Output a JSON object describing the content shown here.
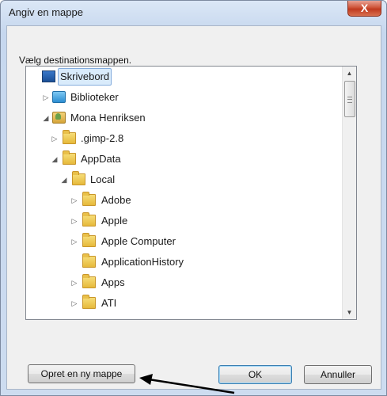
{
  "dialog": {
    "title": "Angiv en mappe",
    "close_label": "X",
    "instruction": "Vælg destinationsmappen."
  },
  "tree": {
    "items": [
      {
        "label": "Skrivebord",
        "icon": "desktop-icon",
        "expander": "none",
        "selected": true
      },
      {
        "label": "Biblioteker",
        "icon": "library-icon",
        "expander": "collapsed"
      },
      {
        "label": "Mona Henriksen",
        "icon": "user-folder-icon",
        "expander": "expanded"
      },
      {
        "label": ".gimp-2.8",
        "icon": "folder-icon",
        "expander": "collapsed"
      },
      {
        "label": "AppData",
        "icon": "folder-icon",
        "expander": "expanded"
      },
      {
        "label": "Local",
        "icon": "folder-icon",
        "expander": "expanded"
      },
      {
        "label": "Adobe",
        "icon": "folder-icon",
        "expander": "collapsed"
      },
      {
        "label": "Apple",
        "icon": "folder-icon",
        "expander": "collapsed"
      },
      {
        "label": "Apple Computer",
        "icon": "folder-icon",
        "expander": "collapsed"
      },
      {
        "label": "ApplicationHistory",
        "icon": "folder-icon",
        "expander": "none"
      },
      {
        "label": "Apps",
        "icon": "folder-icon",
        "expander": "collapsed"
      },
      {
        "label": "ATI",
        "icon": "folder-icon",
        "expander": "collapsed"
      }
    ]
  },
  "buttons": {
    "new_folder": "Opret en ny mappe",
    "ok": "OK",
    "cancel": "Annuller"
  },
  "colors": {
    "accent": "#3c7fb1",
    "selection": "#d9ebfb",
    "annotation_arrow": "#000000"
  }
}
